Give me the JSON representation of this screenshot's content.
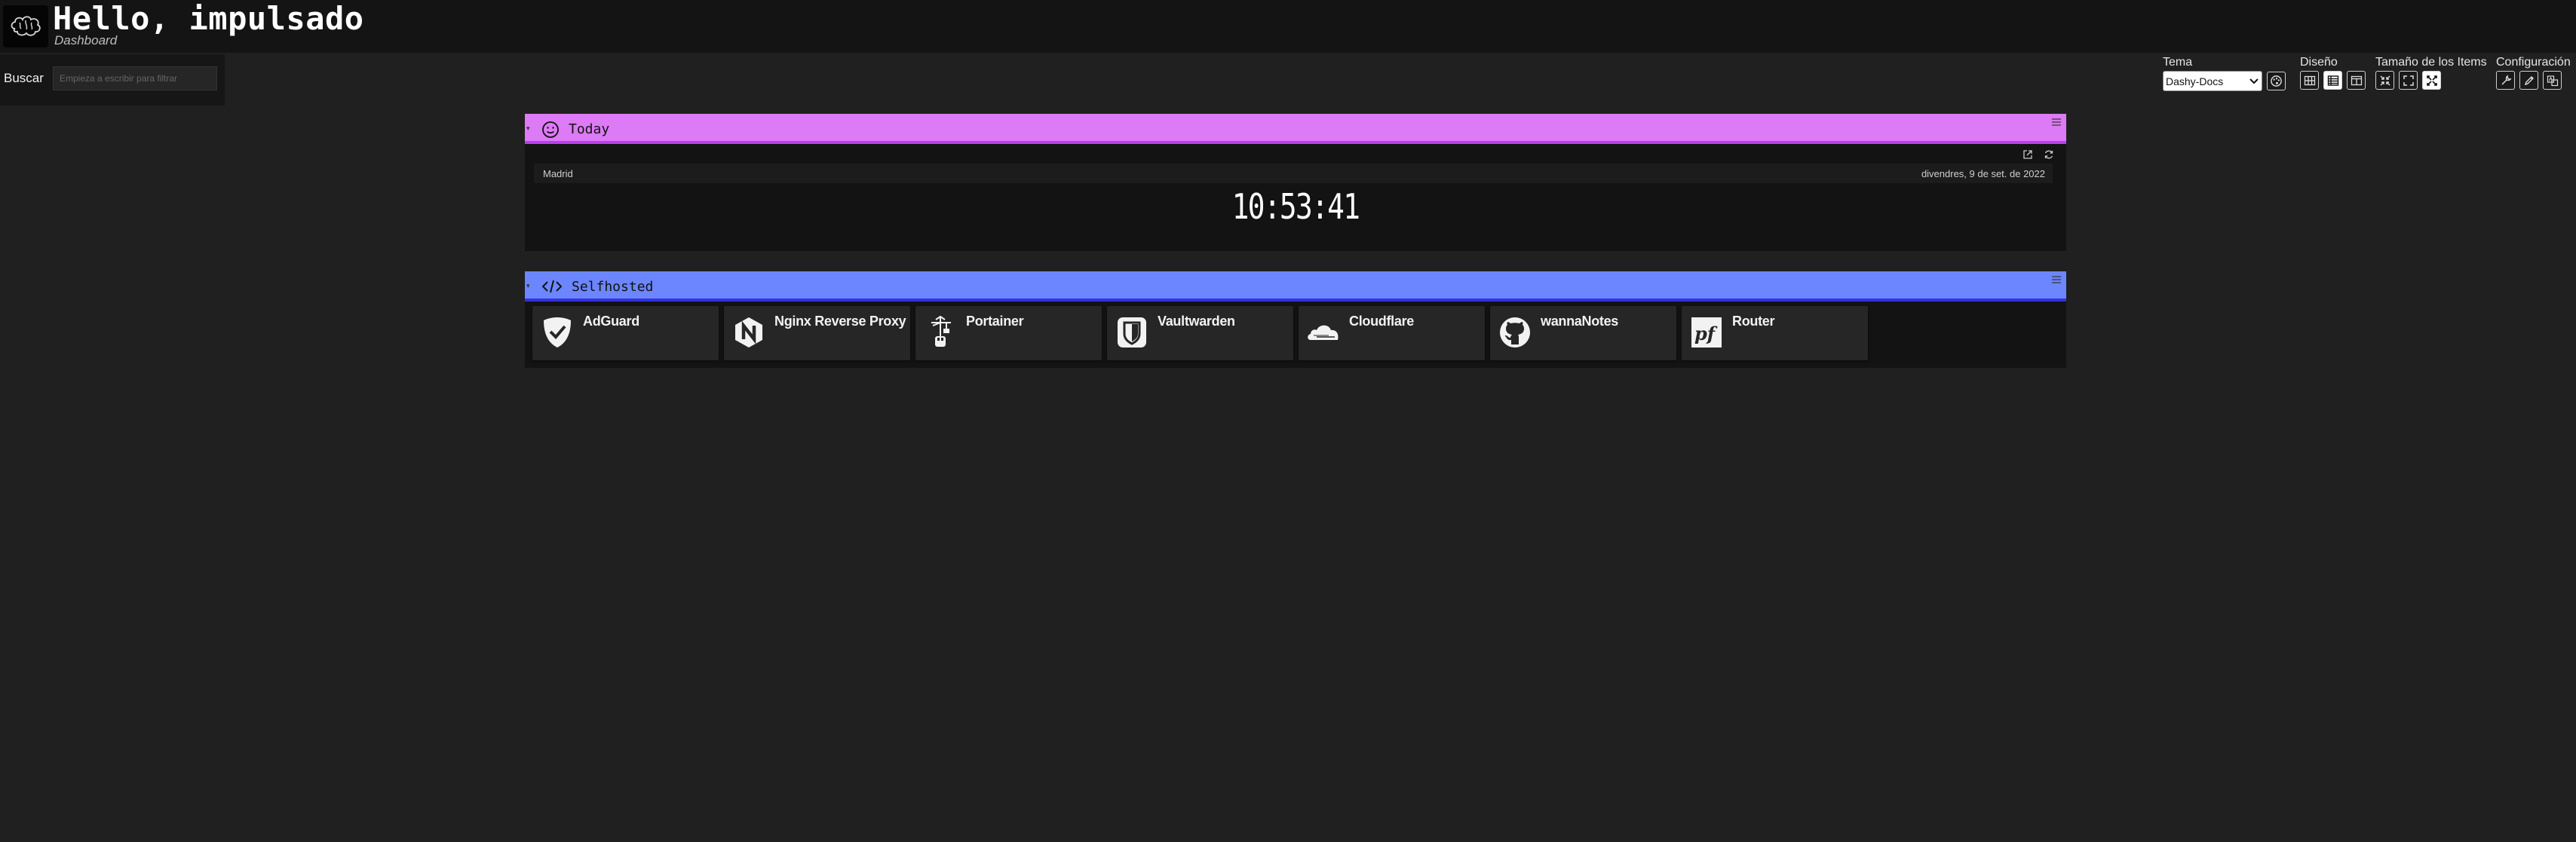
{
  "header": {
    "title": "Hello, impulsado",
    "subtitle": "Dashboard",
    "logo_icon": "brain-icon"
  },
  "search": {
    "label": "Buscar",
    "placeholder": "Empieza a escribir para filtrar"
  },
  "settings": {
    "theme": {
      "label": "Tema",
      "selected": "Dashy-Docs",
      "icon": "palette-icon"
    },
    "layout": {
      "label": "Diseño",
      "options": [
        "auto-layout-icon",
        "horizontal-layout-icon",
        "vertical-layout-icon"
      ],
      "active": 1
    },
    "item_size": {
      "label": "Tamaño de los Items",
      "options": [
        "small-size-icon",
        "medium-size-icon",
        "large-size-icon"
      ],
      "active": 2
    },
    "config": {
      "label": "Configuración",
      "options": [
        "edit-config-icon",
        "interactive-editor-icon",
        "language-icon"
      ]
    }
  },
  "sections": {
    "today": {
      "title": "Today",
      "icon": "smiley-icon",
      "color": "#dd7af5",
      "underline": "#b83ff0",
      "clock": {
        "city": "Madrid",
        "date": "divendres, 9 de set. de 2022",
        "time": "10:53:41"
      }
    },
    "selfhosted": {
      "title": "Selfhosted",
      "icon": "code-icon",
      "color": "#6b86ff",
      "underline": "#3333dd",
      "items": [
        {
          "label": "AdGuard",
          "icon": "adguard-shield-icon"
        },
        {
          "label": "Nginx Reverse Proxy",
          "icon": "nginx-icon"
        },
        {
          "label": "Portainer",
          "icon": "portainer-crane-icon"
        },
        {
          "label": "Vaultwarden",
          "icon": "vaultwarden-shield-icon"
        },
        {
          "label": "Cloudflare",
          "icon": "cloudflare-cloud-icon"
        },
        {
          "label": "wannaNotes",
          "icon": "github-icon"
        },
        {
          "label": "Router",
          "icon": "pfsense-icon"
        }
      ]
    }
  }
}
